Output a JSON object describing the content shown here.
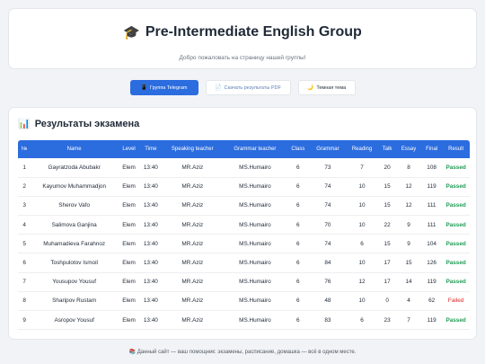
{
  "header": {
    "icon": "graduation-cap-icon",
    "title": "Pre-Intermediate English Group",
    "subtitle": "Добро пожаловать на страницу нашей группы!"
  },
  "buttons": {
    "telegram": {
      "icon": "phone-icon",
      "label": "Группа Telegram"
    },
    "pdf": {
      "icon": "document-icon",
      "label": "Скачать результаты PDF"
    },
    "theme": {
      "icon": "moon-icon",
      "label": "Темная тема"
    }
  },
  "results": {
    "icon": "bar-chart-icon",
    "title": "Результаты экзамена",
    "columns": [
      "№",
      "Name",
      "Level",
      "Time",
      "Speaking teacher",
      "Grammar teacher",
      "Class",
      "Grammar",
      "Reading",
      "Talk",
      "Essay",
      "Final",
      "Result"
    ],
    "rows": [
      [
        "1",
        "Gayratzoda Abubakr",
        "Elem",
        "13:40",
        "MR.Aziz",
        "MS.Humairo",
        "6",
        "73",
        "7",
        "20",
        "8",
        "108",
        "Passed"
      ],
      [
        "2",
        "Kayumov Muhammadjon",
        "Elem",
        "13:40",
        "MR.Aziz",
        "MS.Humairo",
        "6",
        "74",
        "10",
        "15",
        "12",
        "119",
        "Passed"
      ],
      [
        "3",
        "Sherov Vafo",
        "Elem",
        "13:40",
        "MR.Aziz",
        "MS.Humairo",
        "6",
        "74",
        "10",
        "15",
        "12",
        "111",
        "Passed"
      ],
      [
        "4",
        "Salimova Ganjina",
        "Elem",
        "13:40",
        "MR.Aziz",
        "MS.Humairo",
        "6",
        "70",
        "10",
        "22",
        "9",
        "111",
        "Passed"
      ],
      [
        "5",
        "Muhamadieva Farahnoz",
        "Elem",
        "13:40",
        "MR.Aziz",
        "MS.Humairo",
        "6",
        "74",
        "6",
        "15",
        "9",
        "104",
        "Passed"
      ],
      [
        "6",
        "Toshpulotov Ismoil",
        "Elem",
        "13:40",
        "MR.Aziz",
        "MS.Humairo",
        "6",
        "84",
        "10",
        "17",
        "15",
        "126",
        "Passed"
      ],
      [
        "7",
        "Yousupov Yousuf",
        "Elem",
        "13:40",
        "MR.Aziz",
        "MS.Humairo",
        "6",
        "76",
        "12",
        "17",
        "14",
        "119",
        "Passed"
      ],
      [
        "8",
        "Sharipov Rustam",
        "Elem",
        "13:40",
        "MR.Aziz",
        "MS.Humairo",
        "6",
        "48",
        "10",
        "0",
        "4",
        "62",
        "Failed"
      ],
      [
        "9",
        "Asropov Yousuf",
        "Elem",
        "13:40",
        "MR.Aziz",
        "MS.Humairo",
        "6",
        "83",
        "6",
        "23",
        "7",
        "119",
        "Passed"
      ]
    ]
  },
  "colors": {
    "accent": "#2b6cdf",
    "passed": "#1f9d55",
    "failed": "#e02424"
  },
  "footer": {
    "icon": "books-icon",
    "text": "Данный сайт — ваш помощник: экзамены, расписание, домашка — всё в одном месте."
  }
}
